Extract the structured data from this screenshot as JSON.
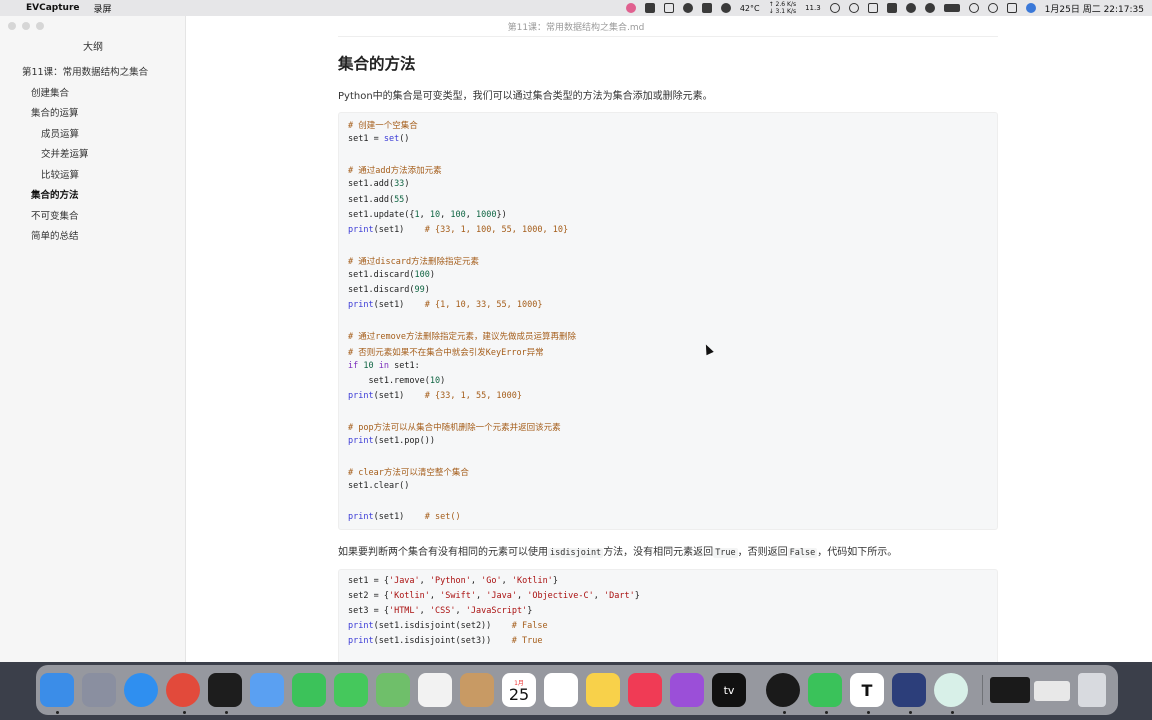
{
  "menubar": {
    "app_name": "EVCapture",
    "menu_item": "录屏",
    "cpu_temp": "42°C",
    "net_up": "↑ 2.6 K/s",
    "net_down": "↓ 3.1 K/s",
    "stat": "11.3",
    "datetime": "1月25日 周二 22:17:35"
  },
  "window": {
    "title": "第11课：常用数据结构之集合.md"
  },
  "sidebar": {
    "title": "大纲",
    "items": [
      {
        "label": "第11课：常用数据结构之集合",
        "level": 1
      },
      {
        "label": "创建集合",
        "level": 2
      },
      {
        "label": "集合的运算",
        "level": 2
      },
      {
        "label": "成员运算",
        "level": 3
      },
      {
        "label": "交并差运算",
        "level": 3
      },
      {
        "label": "比较运算",
        "level": 3
      },
      {
        "label": "集合的方法",
        "level": 2,
        "active": true
      },
      {
        "label": "不可变集合",
        "level": 2
      },
      {
        "label": "简单的总结",
        "level": 2
      }
    ]
  },
  "doc": {
    "heading": "集合的方法",
    "para1": "Python中的集合是可变类型，我们可以通过集合类型的方法为集合添加或删除元素。",
    "code1": [
      "# 创建一个空集合",
      "set1 = set()",
      "",
      "# 通过add方法添加元素",
      "set1.add(33)",
      "set1.add(55)",
      "set1.update({1, 10, 100, 1000})",
      "print(set1)    # {33, 1, 100, 55, 1000, 10}",
      "",
      "# 通过discard方法删除指定元素",
      "set1.discard(100)",
      "set1.discard(99)",
      "print(set1)    # {1, 10, 33, 55, 1000}",
      "",
      "# 通过remove方法删除指定元素，建议先做成员运算再删除",
      "# 否则元素如果不在集合中就会引发KeyError异常",
      "if 10 in set1:",
      "    set1.remove(10)",
      "print(set1)    # {33, 1, 55, 1000}",
      "",
      "# pop方法可以从集合中随机删除一个元素并返回该元素",
      "print(set1.pop())",
      "",
      "# clear方法可以清空整个集合",
      "set1.clear()",
      "",
      "print(set1)    # set()"
    ],
    "para2": {
      "t1": "如果要判断两个集合有没有相同的元素可以使用",
      "c1": "isdisjoint",
      "t2": "方法，没有相同元素返回",
      "c2": "True",
      "t3": "，否则返回",
      "c3": "False",
      "t4": "，代码如下所示。"
    },
    "code2": [
      "set1 = {'Java', 'Python', 'Go', 'Kotlin'}",
      "set2 = {'Kotlin', 'Swift', 'Java', 'Objective-C', 'Dart'}",
      "set3 = {'HTML', 'CSS', 'JavaScript'}",
      "print(set1.isdisjoint(set2))    # False",
      "print(set1.isdisjoint(set3))    # True"
    ]
  },
  "dock": {
    "calendar_month": "1月",
    "calendar_day": "25",
    "apps": [
      "finder-icon",
      "launchpad-icon",
      "safari-icon",
      "chrome-icon",
      "terminal-icon",
      "mail-icon",
      "facetime-icon",
      "messages-icon",
      "maps-icon",
      "photos-icon",
      "contacts-icon",
      "calendar-icon",
      "reminders-icon",
      "notes-icon",
      "music-icon",
      "podcasts-icon",
      "appletv-icon",
      "qq-icon",
      "wechat-icon",
      "typora-icon",
      "evcapture-icon",
      "evcapture-ev-icon"
    ],
    "tv_label": "tv",
    "typora_letter": "T"
  }
}
